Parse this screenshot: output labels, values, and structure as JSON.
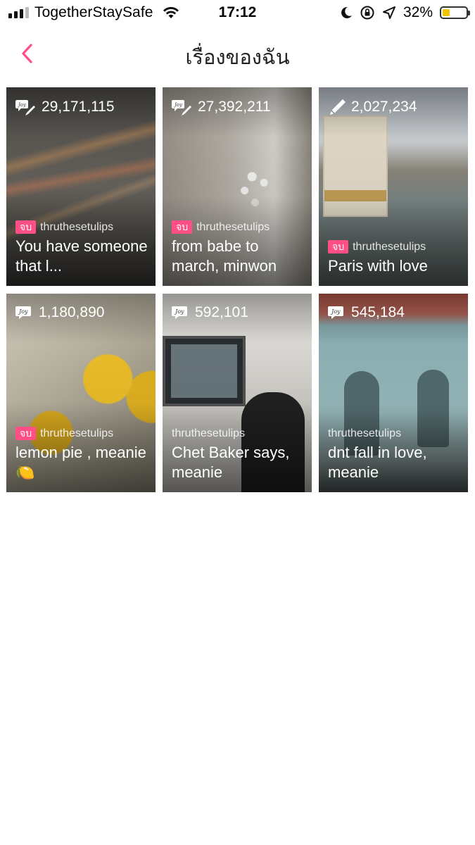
{
  "status_bar": {
    "carrier": "TogetherStaySafe",
    "time": "17:12",
    "battery_percent": "32%",
    "battery_level": 0.32,
    "icons": [
      "signal-icon",
      "wifi-icon",
      "moon-icon",
      "rotation-lock-icon",
      "location-arrow-icon",
      "battery-icon"
    ]
  },
  "nav": {
    "title": "เรื่องของฉัน",
    "back_icon": "chevron-left-icon",
    "accent": "#ff4f86"
  },
  "stories": [
    {
      "count": "29,171,115",
      "icon": "joy-pen-icon",
      "badge": "จบ",
      "author": "thruthesetulips",
      "title": "You have someone that l..."
    },
    {
      "count": "27,392,211",
      "icon": "joy-pen-icon",
      "badge": "จบ",
      "author": "thruthesetulips",
      "title": "from babe to march, minwon"
    },
    {
      "count": "2,027,234",
      "icon": "pen-icon",
      "badge": "จบ",
      "author": "thruthesetulips",
      "title": "Paris with love"
    },
    {
      "count": "1,180,890",
      "icon": "joy-icon",
      "badge": "จบ",
      "author": "thruthesetulips",
      "title": "lemon pie , meanie🍋"
    },
    {
      "count": "592,101",
      "icon": "joy-icon",
      "badge": "",
      "author": "thruthesetulips",
      "title": "Chet Baker says, meanie"
    },
    {
      "count": "545,184",
      "icon": "joy-icon",
      "badge": "",
      "author": "thruthesetulips",
      "title": "dnt fall in love, meanie"
    }
  ]
}
